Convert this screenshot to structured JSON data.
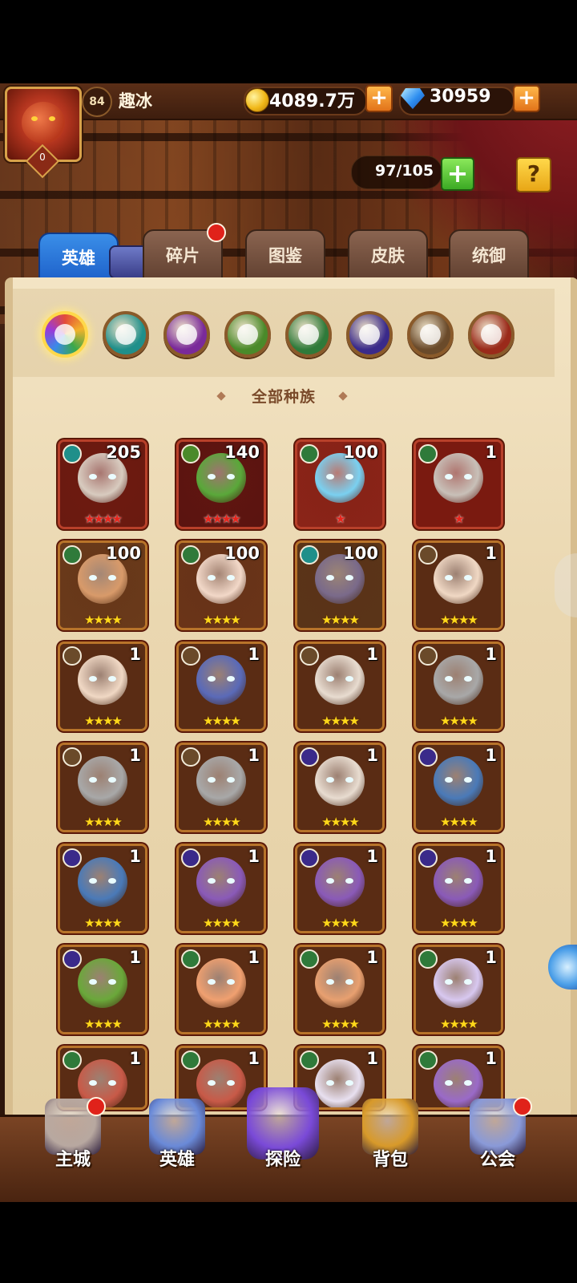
{
  "player": {
    "level": "84",
    "name": "趣冰",
    "vip_level": "0",
    "gold": "4089.7万",
    "diamonds": "30959",
    "hero_slots": "97/105"
  },
  "tabs": [
    {
      "label": "英雄",
      "active": true
    },
    {
      "label": "碎片",
      "active": false,
      "badge": true
    },
    {
      "label": "图鉴",
      "active": false
    },
    {
      "label": "皮肤",
      "active": false
    },
    {
      "label": "统御",
      "active": false
    }
  ],
  "race_filters": [
    {
      "name": "all-races-icon",
      "color": "#e34a3a",
      "active": true
    },
    {
      "name": "race-1-icon",
      "color": "#1f8f8a"
    },
    {
      "name": "race-2-icon",
      "color": "#7a2a9a"
    },
    {
      "name": "race-3-icon",
      "color": "#4a8a2a"
    },
    {
      "name": "race-4-icon",
      "color": "#2f7a3a"
    },
    {
      "name": "race-5-icon",
      "color": "#3a2a8a"
    },
    {
      "name": "race-6-icon",
      "color": "#6a4a2a"
    },
    {
      "name": "race-7-icon",
      "color": "#9a2a1a"
    }
  ],
  "filter_label": "全部种族",
  "heroes": [
    {
      "level": "205",
      "stars": 4,
      "star_color": "red",
      "race_color": "#1f8f8a",
      "frame": "red",
      "skin": "#d8cbbf",
      "bg": "#6a1a10"
    },
    {
      "level": "140",
      "stars": 4,
      "star_color": "red",
      "race_color": "#4a8a2a",
      "frame": "red",
      "skin": "#5aa83a",
      "bg": "#5a1410"
    },
    {
      "level": "100",
      "stars": 1,
      "star_color": "red",
      "race_color": "#2f7a3a",
      "frame": "red",
      "skin": "#7ad0f0",
      "bg": "#8a2418"
    },
    {
      "level": "1",
      "stars": 1,
      "star_color": "red",
      "race_color": "#2f7a3a",
      "frame": "red",
      "skin": "#c8c0b8",
      "bg": "#7a1a10"
    },
    {
      "level": "100",
      "stars": 4,
      "star_color": "yellow",
      "race_color": "#2f7a3a",
      "frame": "gold",
      "skin": "#d89a6a",
      "bg": "#6a3a1a"
    },
    {
      "level": "100",
      "stars": 4,
      "star_color": "yellow",
      "race_color": "#2f7a3a",
      "frame": "gold",
      "skin": "#f2d8c8",
      "bg": "#6a3418"
    },
    {
      "level": "100",
      "stars": 4,
      "star_color": "yellow",
      "race_color": "#1f8f8a",
      "frame": "gold",
      "skin": "#7a6a8a",
      "bg": "#5a3418"
    },
    {
      "level": "1",
      "stars": 4,
      "star_color": "yellow",
      "race_color": "#6a4a2a",
      "frame": "gold",
      "skin": "#f0d8c4",
      "bg": "#5a2c14"
    },
    {
      "level": "1",
      "stars": 4,
      "star_color": "yellow",
      "race_color": "#6a4a2a",
      "frame": "gold",
      "skin": "#f0d8c4",
      "bg": "#5a2c14"
    },
    {
      "level": "1",
      "stars": 4,
      "star_color": "yellow",
      "race_color": "#6a4a2a",
      "frame": "gold",
      "skin": "#5a6ab8",
      "bg": "#5a2c14"
    },
    {
      "level": "1",
      "stars": 4,
      "star_color": "yellow",
      "race_color": "#6a4a2a",
      "frame": "gold",
      "skin": "#e8dcd0",
      "bg": "#5a2c14"
    },
    {
      "level": "1",
      "stars": 4,
      "star_color": "yellow",
      "race_color": "#6a4a2a",
      "frame": "gold",
      "skin": "#a8a8a8",
      "bg": "#5a2c14"
    },
    {
      "level": "1",
      "stars": 4,
      "star_color": "yellow",
      "race_color": "#6a4a2a",
      "frame": "gold",
      "skin": "#a8a8a8",
      "bg": "#5a2c14"
    },
    {
      "level": "1",
      "stars": 4,
      "star_color": "yellow",
      "race_color": "#6a4a2a",
      "frame": "gold",
      "skin": "#a8a8a8",
      "bg": "#5a2c14"
    },
    {
      "level": "1",
      "stars": 4,
      "star_color": "yellow",
      "race_color": "#3a2a8a",
      "frame": "gold",
      "skin": "#e8dcd0",
      "bg": "#5a2c14"
    },
    {
      "level": "1",
      "stars": 4,
      "star_color": "yellow",
      "race_color": "#3a2a8a",
      "frame": "gold",
      "skin": "#4a7ab8",
      "bg": "#5a2c14"
    },
    {
      "level": "1",
      "stars": 4,
      "star_color": "yellow",
      "race_color": "#3a2a8a",
      "frame": "gold",
      "skin": "#4a7ab8",
      "bg": "#5a2c14"
    },
    {
      "level": "1",
      "stars": 4,
      "star_color": "yellow",
      "race_color": "#3a2a8a",
      "frame": "gold",
      "skin": "#8a5ab8",
      "bg": "#5a2c14"
    },
    {
      "level": "1",
      "stars": 4,
      "star_color": "yellow",
      "race_color": "#3a2a8a",
      "frame": "gold",
      "skin": "#8a5ab8",
      "bg": "#5a2c14"
    },
    {
      "level": "1",
      "stars": 4,
      "star_color": "yellow",
      "race_color": "#3a2a8a",
      "frame": "gold",
      "skin": "#8a5ab8",
      "bg": "#5a2c14"
    },
    {
      "level": "1",
      "stars": 4,
      "star_color": "yellow",
      "race_color": "#3a2a8a",
      "frame": "gold",
      "skin": "#6aa83a",
      "bg": "#5a2c14"
    },
    {
      "level": "1",
      "stars": 4,
      "star_color": "yellow",
      "race_color": "#2f7a3a",
      "frame": "gold",
      "skin": "#f0a070",
      "bg": "#5a2c14"
    },
    {
      "level": "1",
      "stars": 4,
      "star_color": "yellow",
      "race_color": "#2f7a3a",
      "frame": "gold",
      "skin": "#e8a070",
      "bg": "#5a2c14"
    },
    {
      "level": "1",
      "stars": 4,
      "star_color": "yellow",
      "race_color": "#2f7a3a",
      "frame": "gold",
      "skin": "#d8c8f0",
      "bg": "#5a2c14"
    },
    {
      "level": "1",
      "stars": 0,
      "star_color": "yellow",
      "race_color": "#2f7a3a",
      "frame": "gold",
      "skin": "#c85a48",
      "bg": "#5a2c14"
    },
    {
      "level": "1",
      "stars": 0,
      "star_color": "yellow",
      "race_color": "#2f7a3a",
      "frame": "gold",
      "skin": "#c85a48",
      "bg": "#5a2c14"
    },
    {
      "level": "1",
      "stars": 0,
      "star_color": "yellow",
      "race_color": "#2f7a3a",
      "frame": "gold",
      "skin": "#e8e0f0",
      "bg": "#5a2c14"
    },
    {
      "level": "1",
      "stars": 0,
      "star_color": "yellow",
      "race_color": "#2f7a3a",
      "frame": "gold",
      "skin": "#9a6ac8",
      "bg": "#5a2c14"
    }
  ],
  "bottom_nav": [
    {
      "label": "主城",
      "icon": "castle-icon",
      "color": "#b8a8a0",
      "badge": true
    },
    {
      "label": "英雄",
      "icon": "hero-icon",
      "color": "#6a8ad8",
      "badge": false
    },
    {
      "label": "探险",
      "icon": "portal-icon",
      "color": "#7a4ad8",
      "badge": false
    },
    {
      "label": "背包",
      "icon": "backpack-icon",
      "color": "#d89a2a",
      "badge": false
    },
    {
      "label": "公会",
      "icon": "guild-icon",
      "color": "#8a9ad8",
      "badge": true
    }
  ]
}
